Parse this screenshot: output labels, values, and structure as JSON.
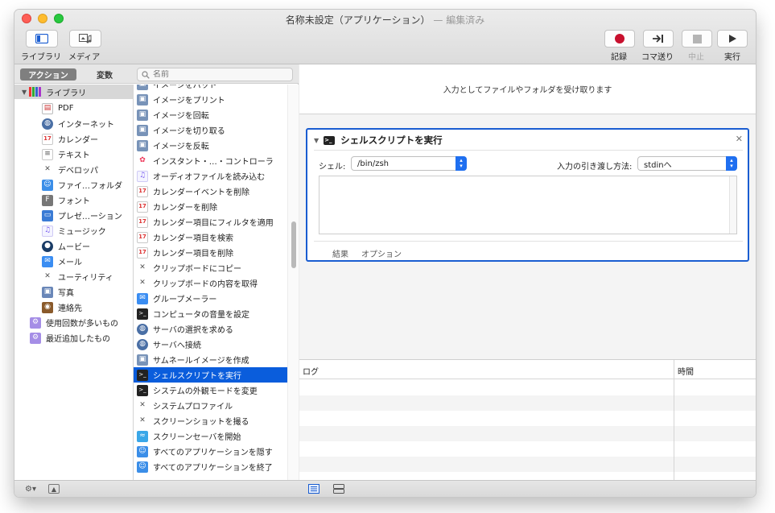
{
  "window": {
    "title": "名称未設定（アプリケーション）",
    "edited": "— 編集済み"
  },
  "toolbar": {
    "library_label": "ライブラリ",
    "media_label": "メディア",
    "record_label": "記録",
    "step_label": "コマ送り",
    "stop_label": "中止",
    "run_label": "実行"
  },
  "tabs": {
    "actions": "アクション",
    "variables": "変数"
  },
  "search": {
    "placeholder": "名前"
  },
  "library": {
    "root": "ライブラリ",
    "items": [
      {
        "label": "PDF",
        "icon": "pdf-icon"
      },
      {
        "label": "インターネット",
        "icon": "globe-icon"
      },
      {
        "label": "カレンダー",
        "icon": "calendar-icon"
      },
      {
        "label": "テキスト",
        "icon": "text-icon"
      },
      {
        "label": "デベロッパ",
        "icon": "tools-icon"
      },
      {
        "label": "ファイ…フォルダ",
        "icon": "finder-icon"
      },
      {
        "label": "フォント",
        "icon": "font-icon"
      },
      {
        "label": "プレゼ…ーション",
        "icon": "presentation-icon"
      },
      {
        "label": "ミュージック",
        "icon": "music-icon"
      },
      {
        "label": "ムービー",
        "icon": "movie-icon"
      },
      {
        "label": "メール",
        "icon": "mail-icon"
      },
      {
        "label": "ユーティリティ",
        "icon": "tools-icon"
      },
      {
        "label": "写真",
        "icon": "photo-icon"
      },
      {
        "label": "連絡先",
        "icon": "contacts-icon"
      }
    ],
    "smart": [
      {
        "label": "使用回数が多いもの",
        "icon": "smart-folder-icon"
      },
      {
        "label": "最近追加したもの",
        "icon": "smart-folder-icon"
      }
    ]
  },
  "actions": [
    {
      "label": "イメージをパッド",
      "icon": "preview-icon"
    },
    {
      "label": "イメージをプリント",
      "icon": "preview-icon"
    },
    {
      "label": "イメージを回転",
      "icon": "preview-icon"
    },
    {
      "label": "イメージを切り取る",
      "icon": "preview-icon"
    },
    {
      "label": "イメージを反転",
      "icon": "preview-icon"
    },
    {
      "label": "インスタント・…・コントローラ",
      "icon": "photos-icon"
    },
    {
      "label": "オーディオファイルを読み込む",
      "icon": "music-icon"
    },
    {
      "label": "カレンダーイベントを削除",
      "icon": "calendar-icon"
    },
    {
      "label": "カレンダーを削除",
      "icon": "calendar-icon"
    },
    {
      "label": "カレンダー項目にフィルタを適用",
      "icon": "calendar-icon"
    },
    {
      "label": "カレンダー項目を検索",
      "icon": "calendar-icon"
    },
    {
      "label": "カレンダー項目を削除",
      "icon": "calendar-icon"
    },
    {
      "label": "クリップボードにコピー",
      "icon": "tools-icon"
    },
    {
      "label": "クリップボードの内容を取得",
      "icon": "tools-icon"
    },
    {
      "label": "グループメーラー",
      "icon": "mail-icon"
    },
    {
      "label": "コンピュータの音量を設定",
      "icon": "terminal-icon"
    },
    {
      "label": "サーバの選択を求める",
      "icon": "globe-icon"
    },
    {
      "label": "サーバへ接続",
      "icon": "globe-icon"
    },
    {
      "label": "サムネールイメージを作成",
      "icon": "preview-icon"
    },
    {
      "label": "シェルスクリプトを実行",
      "icon": "terminal-icon",
      "selected": true
    },
    {
      "label": "システムの外観モードを変更",
      "icon": "terminal-icon"
    },
    {
      "label": "システムプロファイル",
      "icon": "tools-icon"
    },
    {
      "label": "スクリーンショットを撮る",
      "icon": "tools-icon"
    },
    {
      "label": "スクリーンセーバを開始",
      "icon": "screensaver-icon"
    },
    {
      "label": "すべてのアプリケーションを隠す",
      "icon": "finder-icon"
    },
    {
      "label": "すべてのアプリケーションを終了",
      "icon": "finder-icon"
    }
  ],
  "workflow": {
    "receive_text": "入力としてファイルやフォルダを受け取ります",
    "action_title": "シェルスクリプトを実行",
    "shell_label": "シェル:",
    "shell_value": "/bin/zsh",
    "input_label": "入力の引き渡し方法:",
    "input_value": "stdinへ",
    "script": "",
    "footer_results": "結果",
    "footer_options": "オプション"
  },
  "log": {
    "col_log": "ログ",
    "col_time": "時間"
  },
  "colors": {
    "selection": "#0a5ddc",
    "action_border": "#1a5dd1",
    "record": "#c8102e"
  }
}
